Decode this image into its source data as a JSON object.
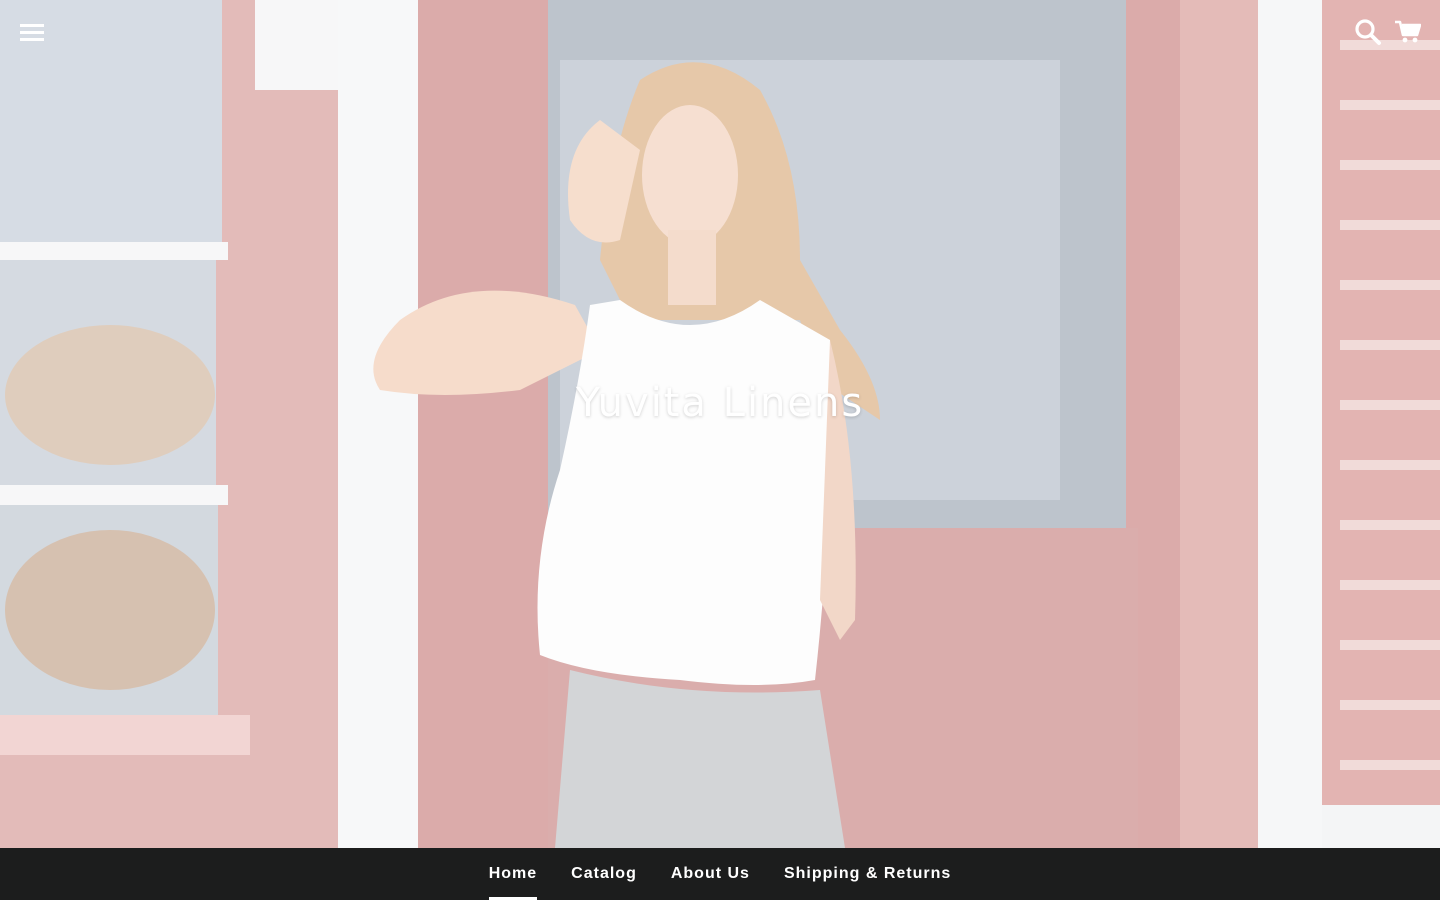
{
  "site": {
    "title": "Yuvita Linens"
  },
  "header": {
    "menu_icon": "hamburger-menu-icon",
    "search_icon": "search-icon",
    "cart_icon": "shopping-cart-icon"
  },
  "nav": {
    "items": [
      {
        "label": "Home",
        "active": true
      },
      {
        "label": "Catalog",
        "active": false
      },
      {
        "label": "About Us",
        "active": false
      },
      {
        "label": "Shipping & Returns",
        "active": false
      }
    ]
  },
  "colors": {
    "nav_background": "#1c1d1d",
    "nav_text": "#ffffff",
    "title_text": "#ffffff",
    "door_red": "#c97a78",
    "wall_white": "#e8eaee"
  }
}
